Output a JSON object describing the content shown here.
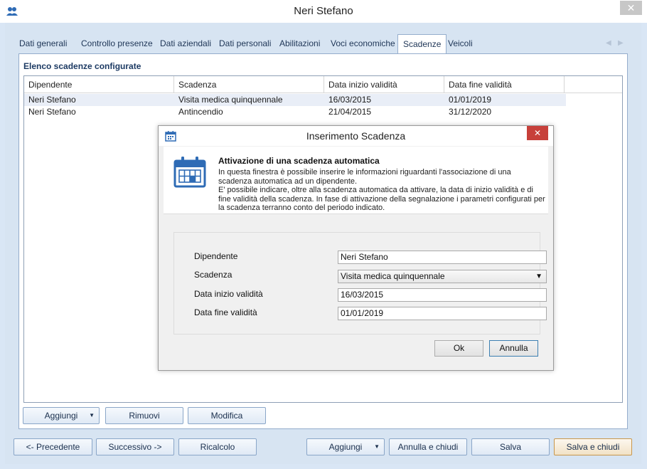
{
  "window": {
    "title": "Neri Stefano",
    "close": "✕"
  },
  "tabs": [
    "Dati generali",
    "Controllo presenze",
    "Dati aziendali",
    "Dati personali",
    "Abilitazioni",
    "Voci economiche",
    "Scadenze",
    "Veicoli"
  ],
  "active_tab": "Scadenze",
  "tab_scroll": {
    "left": "◀",
    "right": "▶"
  },
  "panel": {
    "title": "Elenco scadenze configurate",
    "columns": [
      "Dipendente",
      "Scadenza",
      "Data inizio validità",
      "Data fine validità"
    ],
    "rows": [
      [
        "Neri Stefano",
        "Visita medica quinquennale",
        "16/03/2015",
        "01/01/2019"
      ],
      [
        "Neri Stefano",
        "Antincendio",
        "21/04/2015",
        "31/12/2020"
      ]
    ],
    "buttons": {
      "add": "Aggiungi",
      "remove": "Rimuovi",
      "edit": "Modifica"
    }
  },
  "footer": {
    "prev": "<- Precedente",
    "next": "Successivo ->",
    "recalc": "Ricalcolo",
    "add": "Aggiungi",
    "cancel_close": "Annulla e chiudi",
    "save": "Salva",
    "save_close": "Salva e chiudi"
  },
  "dialog": {
    "title": "Inserimento Scadenza",
    "close": "✕",
    "heading": "Attivazione di una scadenza automatica",
    "desc_1": "In questa finestra è possibile inserire le informazioni riguardanti l'associazione di una scadenza automatica ad un dipendente.",
    "desc_2": "E' possibile indicare, oltre alla scadenza automatica da attivare, la data di inizio validità e di fine validità della scadenza. In fase di attivazione della segnalazione i parametri configurati per la scadenza terranno conto del periodo indicato.",
    "fields": {
      "employee": {
        "label": "Dipendente",
        "value": "Neri Stefano"
      },
      "deadline": {
        "label": "Scadenza",
        "value": "Visita medica quinquennale"
      },
      "start": {
        "label": "Data inizio validità",
        "value": "16/03/2015"
      },
      "end": {
        "label": "Data fine validità",
        "value": "01/01/2019"
      }
    },
    "ok": "Ok",
    "cancel": "Annulla"
  },
  "colors": {
    "accent": "#1c3a63",
    "dialog_close": "#c7403a",
    "icon_blue": "#2e6bb5"
  }
}
